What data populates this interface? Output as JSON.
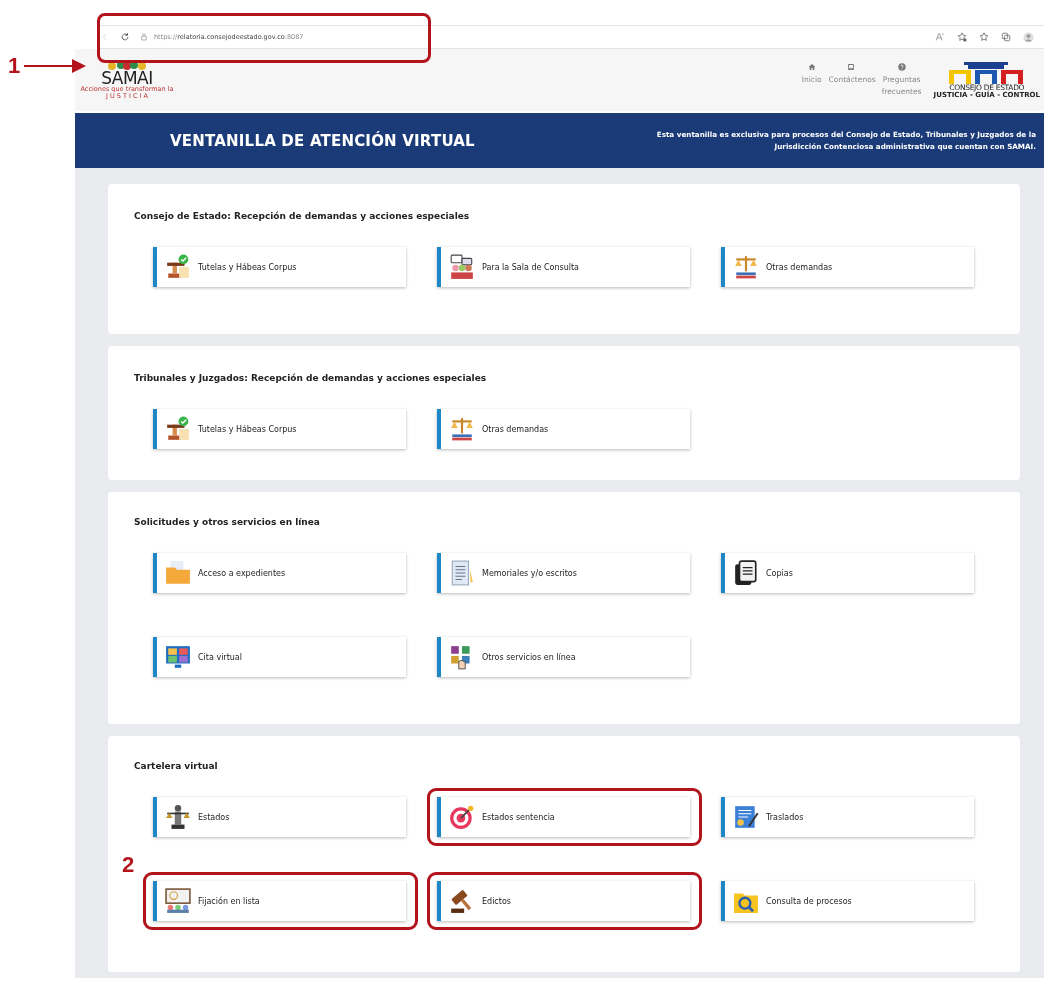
{
  "browser": {
    "url": "https://**relatoria.consejodeestado.gov.co**:8087",
    "highlighted": true
  },
  "header": {
    "logo": {
      "name": "SAMAI",
      "tagline": "Acciones que transforman la",
      "tagline_2": "J U S T I C I A"
    },
    "nav": [
      {
        "label": "Inicio"
      },
      {
        "label": "Contáctenos"
      },
      {
        "label": "Preguntas frecuentes"
      }
    ],
    "emblem": {
      "name": "CONSEJO DE ESTADO",
      "motto": "JUSTICIA - GUÍA - CONTROL"
    }
  },
  "banner": {
    "title": "VENTANILLA DE ATENCIÓN VIRTUAL",
    "description": "Esta ventanilla es exclusiva para procesos del Consejo de Estado, Tribunales y Juzgados de la Jurisdicción Contenciosa administrativa que cuentan con SAMAI."
  },
  "sections": [
    {
      "title": "Consejo de Estado: Recepción de demandas y acciones especiales",
      "items": [
        {
          "label": "Tutelas y Hábeas Corpus",
          "highlighted": false
        },
        {
          "label": "Para la Sala de Consulta",
          "highlighted": false
        },
        {
          "label": "Otras demandas",
          "highlighted": false
        }
      ]
    },
    {
      "title": "Tribunales y Juzgados: Recepción de demandas y acciones especiales",
      "items": [
        {
          "label": "Tutelas y Hábeas Corpus",
          "highlighted": false
        },
        {
          "label": "Otras demandas",
          "highlighted": false
        }
      ]
    },
    {
      "title": "Solicitudes y otros servicios en línea",
      "items": [
        {
          "label": "Acceso a expedientes",
          "highlighted": false
        },
        {
          "label": "Memoriales y/o escritos",
          "highlighted": false
        },
        {
          "label": "Copias",
          "highlighted": false
        },
        {
          "label": "Cita virtual",
          "highlighted": false
        },
        {
          "label": "Otros servicios en línea",
          "highlighted": false
        }
      ]
    },
    {
      "title": "Cartelera virtual",
      "items": [
        {
          "label": "Estados",
          "highlighted": false
        },
        {
          "label": "Estados sentencia",
          "highlighted": true
        },
        {
          "label": "Traslados",
          "highlighted": false
        },
        {
          "label": "Fijación en lista",
          "highlighted": true
        },
        {
          "label": "Edictos",
          "highlighted": true
        },
        {
          "label": "Consulta de procesos",
          "highlighted": false
        }
      ]
    }
  ],
  "callouts": [
    {
      "number": "1"
    },
    {
      "number": "2"
    }
  ]
}
